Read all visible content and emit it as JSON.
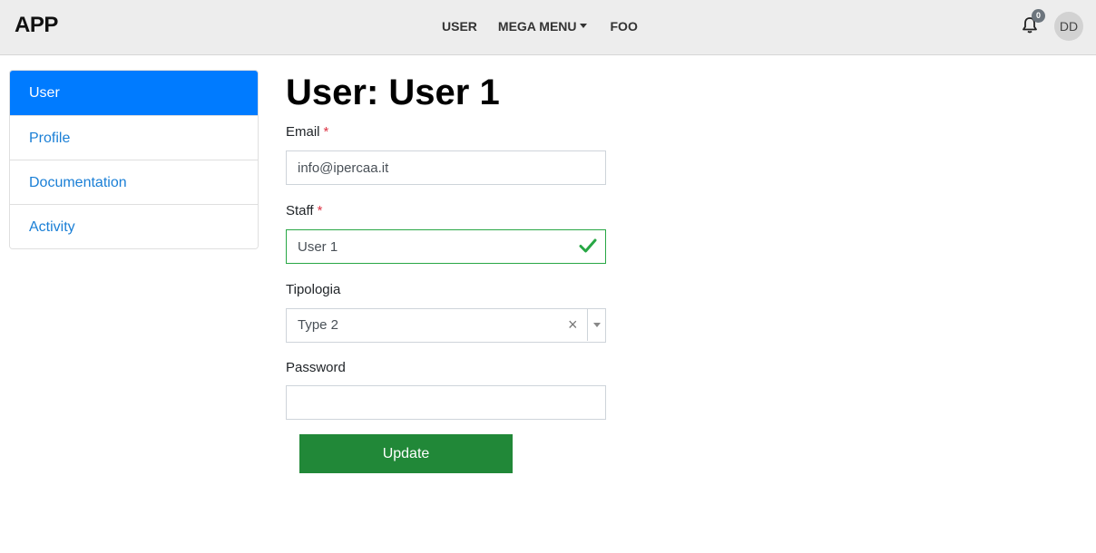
{
  "app": {
    "brand": "APP"
  },
  "nav": {
    "items": [
      {
        "label": "USER"
      },
      {
        "label": "MEGA MENU"
      },
      {
        "label": "FOO"
      }
    ],
    "notifications_count": "0",
    "avatar_initials": "DD"
  },
  "sidebar": {
    "items": [
      {
        "label": "User",
        "active": true
      },
      {
        "label": "Profile"
      },
      {
        "label": "Documentation"
      },
      {
        "label": "Activity"
      }
    ]
  },
  "main": {
    "title": "User: User 1",
    "form": {
      "email": {
        "label": "Email",
        "required_mark": "*",
        "value": "info@ipercaa.it"
      },
      "staff": {
        "label": "Staff",
        "required_mark": "*",
        "value": "User 1",
        "valid": true
      },
      "tipologia": {
        "label": "Tipologia",
        "value": "Type 2",
        "clear_glyph": "×"
      },
      "password": {
        "label": "Password",
        "value": ""
      },
      "submit_label": "Update"
    }
  },
  "colors": {
    "active": "#007bff",
    "link": "#1a7fd6",
    "valid": "#28a745",
    "required": "#dc3545",
    "submit": "#218838"
  }
}
